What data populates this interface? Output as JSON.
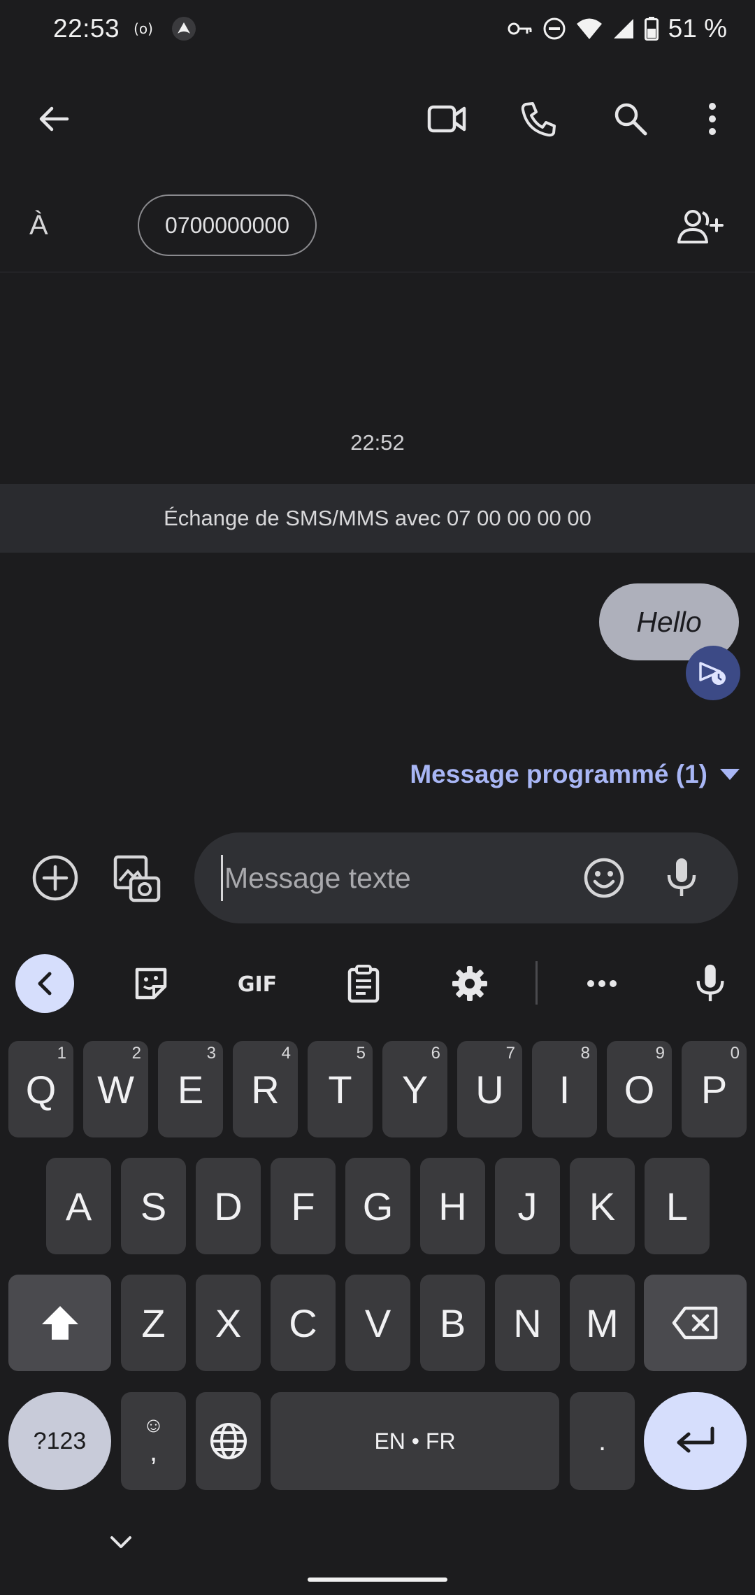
{
  "status_bar": {
    "time": "22:53",
    "battery": "51 %",
    "icons": [
      "hotspot-icon",
      "vpn-shield-icon",
      "key-icon",
      "dnd-icon",
      "wifi-icon",
      "signal-icon",
      "battery-icon"
    ]
  },
  "app_bar": {
    "icons": [
      "back-arrow-icon",
      "video-call-icon",
      "phone-icon",
      "search-icon",
      "more-vert-icon"
    ]
  },
  "recipient": {
    "to_label": "À",
    "chip": "0700000000",
    "add_icon": "add-people-icon"
  },
  "conversation": {
    "timestamp": "22:52",
    "banner": "Échange de SMS/MMS avec 07 00 00 00 00",
    "message": "Hello",
    "scheduled_label": "Message programmé (1)"
  },
  "compose": {
    "placeholder": "Message texte",
    "icons": [
      "add-circle-icon",
      "gallery-icon",
      "emoji-icon",
      "mic-icon"
    ]
  },
  "keyboard": {
    "toolbar_icons": [
      "chevron-left-icon",
      "sticker-icon",
      "gif-icon",
      "clipboard-icon",
      "settings-icon",
      "more-horiz-icon",
      "mic-icon"
    ],
    "gif_label": "GIF",
    "row1": [
      {
        "k": "Q",
        "h": "1"
      },
      {
        "k": "W",
        "h": "2"
      },
      {
        "k": "E",
        "h": "3"
      },
      {
        "k": "R",
        "h": "4"
      },
      {
        "k": "T",
        "h": "5"
      },
      {
        "k": "Y",
        "h": "6"
      },
      {
        "k": "U",
        "h": "7"
      },
      {
        "k": "I",
        "h": "8"
      },
      {
        "k": "O",
        "h": "9"
      },
      {
        "k": "P",
        "h": "0"
      }
    ],
    "row2": [
      "A",
      "S",
      "D",
      "F",
      "G",
      "H",
      "J",
      "K",
      "L"
    ],
    "row3": [
      "Z",
      "X",
      "C",
      "V",
      "B",
      "N",
      "M"
    ],
    "symbols_key": "?123",
    "comma_key": ",",
    "space_key": "EN • FR",
    "period_key": ".",
    "colors": {
      "accent": "#a8b6f5",
      "accent_bg": "#d6defc",
      "key": "#3a3a3d"
    }
  }
}
